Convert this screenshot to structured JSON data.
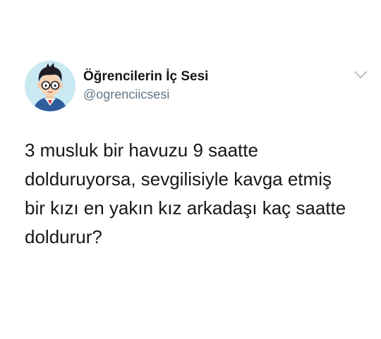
{
  "tweet": {
    "author": {
      "display_name": "Öğrencilerin İç Sesi",
      "handle": "@ogrenciicsesi",
      "avatar_icon": "cartoon-boy-with-glasses-avatar"
    },
    "menu_icon": "chevron-down-icon",
    "text": "3 musluk bir havuzu 9 saatte\ndolduruyorsa, sevgilisiyle kavga etmiş\nbir kızı en yakın kız arkadaşı kaç saatte\ndoldurur?"
  },
  "colors": {
    "text_primary": "#14171a",
    "text_secondary": "#657786",
    "avatar_bg": "#c9e9f3",
    "background": "#ffffff"
  }
}
